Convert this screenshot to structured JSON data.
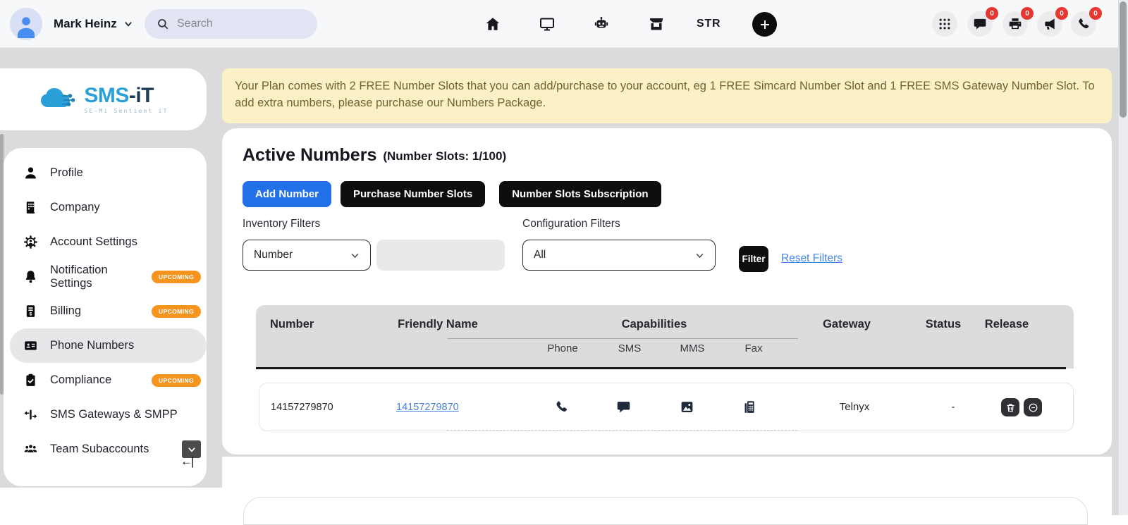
{
  "topbar": {
    "user_name": "Mark Heinz",
    "search_placeholder": "Search",
    "str_label": "STR",
    "center_icons": [
      "home-icon",
      "monitor-icon",
      "robot-icon",
      "store-icon"
    ],
    "right_icons": [
      {
        "icon": "apps-grid-icon",
        "badge": ""
      },
      {
        "icon": "chat-icon",
        "badge": "0"
      },
      {
        "icon": "printer-icon",
        "badge": "0"
      },
      {
        "icon": "megaphone-icon",
        "badge": "0"
      },
      {
        "icon": "phone-icon",
        "badge": "0"
      }
    ]
  },
  "sidebar": {
    "logo": {
      "brand_sms": "SMS",
      "brand_it": "-iT",
      "tagline": "SE-Mi Sentient iT"
    },
    "items": [
      {
        "label": "Profile",
        "icon": "person-icon"
      },
      {
        "label": "Company",
        "icon": "building-icon"
      },
      {
        "label": "Account Settings",
        "icon": "gear-person-icon"
      },
      {
        "label": "Notification Settings",
        "icon": "bell-icon",
        "badge": "UPCOMING"
      },
      {
        "label": "Billing",
        "icon": "billing-icon",
        "badge": "UPCOMING"
      },
      {
        "label": "Phone Numbers",
        "icon": "contact-card-icon",
        "active": true
      },
      {
        "label": "Compliance",
        "icon": "clipboard-check-icon",
        "badge": "UPCOMING"
      },
      {
        "label": "SMS Gateways & SMPP",
        "icon": "gateway-icon"
      },
      {
        "label": "Team Subaccounts",
        "icon": "team-icon",
        "expandable": true
      }
    ]
  },
  "banner": {
    "text": "Your Plan comes with 2 FREE Number Slots that you can add/purchase to your account, eg 1 FREE Simcard Number Slot and 1 FREE SMS Gateway Number Slot. To add extra numbers, please purchase our Numbers Package."
  },
  "main": {
    "title": "Active Numbers",
    "subtitle": "(Number Slots: 1/100)",
    "buttons": {
      "add": "Add Number",
      "purchase": "Purchase Number Slots",
      "subscription": "Number Slots Subscription"
    },
    "filters": {
      "inventory_label": "Inventory Filters",
      "configuration_label": "Configuration Filters",
      "inventory_selected": "Number",
      "inventory_value": "",
      "configuration_selected": "All",
      "filter_button": "Filter",
      "reset_link": "Reset Filters"
    },
    "table": {
      "headers": {
        "number": "Number",
        "friendly_name": "Friendly Name",
        "capabilities": "Capabilities",
        "gateway": "Gateway",
        "status": "Status",
        "release": "Release"
      },
      "sub_headers": {
        "phone": "Phone",
        "sms": "SMS",
        "mms": "MMS",
        "fax": "Fax"
      },
      "rows": [
        {
          "number": "14157279870",
          "friendly_name": "14157279870",
          "capabilities": [
            "phone",
            "sms",
            "mms",
            "fax"
          ],
          "gateway": "Telnyx",
          "status": "-",
          "actions": [
            "delete",
            "release"
          ]
        }
      ]
    }
  },
  "colors": {
    "accent_blue": "#2170e8",
    "badge_orange": "#f7941d",
    "badge_red": "#e53730",
    "banner_bg": "#fbf0c6",
    "logo_blue": "#2b9fd7",
    "panel_gray": "#dbdbdb"
  }
}
